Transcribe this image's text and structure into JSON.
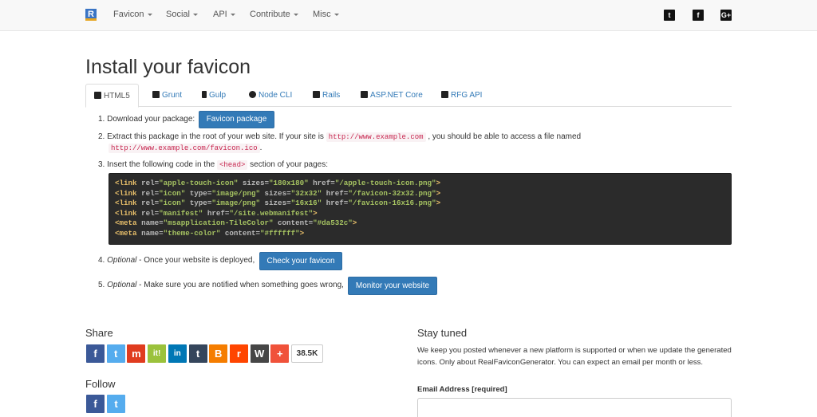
{
  "nav": {
    "brand_letter": "R",
    "items": [
      {
        "label": "Favicon"
      },
      {
        "label": "Social"
      },
      {
        "label": "API"
      },
      {
        "label": "Contribute"
      },
      {
        "label": "Misc"
      }
    ],
    "social": [
      {
        "name": "twitter-icon",
        "glyph": "t"
      },
      {
        "name": "facebook-icon",
        "glyph": "f"
      },
      {
        "name": "google-plus-icon",
        "glyph": "G+"
      }
    ]
  },
  "page_title": "Install your favicon",
  "tabs": [
    {
      "label": "HTML5"
    },
    {
      "label": "Grunt"
    },
    {
      "label": "Gulp"
    },
    {
      "label": "Node CLI"
    },
    {
      "label": "Rails"
    },
    {
      "label": "ASP.NET Core"
    },
    {
      "label": "RFG API"
    }
  ],
  "steps": {
    "s1_text": "1. Download your package:",
    "s1_button": "Favicon package",
    "s2_text_a": "2. Extract this package in the root of your web site. If your site is",
    "s2_code_a": "http://www.example.com",
    "s2_text_b": ", you should be able to access a file named",
    "s2_code_b": "http://www.example.com/favicon.ico",
    "s2_text_c": ".",
    "s3_text_a": "3. Insert the following code in the",
    "s3_code": "<head>",
    "s3_text_b": "section of your pages:",
    "s4_num": "4.",
    "s4_em": "Optional",
    "s4_text": "- Once your website is deployed,",
    "s4_button": "Check your favicon",
    "s5_num": "5.",
    "s5_em": "Optional",
    "s5_text": "- Make sure you are notified when something goes wrong,",
    "s5_button": "Monitor your website"
  },
  "code_lines": [
    {
      "tag": "<link",
      "parts": [
        [
          "rel=",
          "\"apple-touch-icon\""
        ],
        [
          "sizes=",
          "\"180x180\""
        ],
        [
          "href=",
          "\"/apple-touch-icon.png\""
        ]
      ]
    },
    {
      "tag": "<link",
      "parts": [
        [
          "rel=",
          "\"icon\""
        ],
        [
          "type=",
          "\"image/png\""
        ],
        [
          "sizes=",
          "\"32x32\""
        ],
        [
          "href=",
          "\"/favicon-32x32.png\""
        ]
      ]
    },
    {
      "tag": "<link",
      "parts": [
        [
          "rel=",
          "\"icon\""
        ],
        [
          "type=",
          "\"image/png\""
        ],
        [
          "sizes=",
          "\"16x16\""
        ],
        [
          "href=",
          "\"/favicon-16x16.png\""
        ]
      ]
    },
    {
      "tag": "<link",
      "parts": [
        [
          "rel=",
          "\"manifest\""
        ],
        [
          "href=",
          "\"/site.webmanifest\""
        ]
      ]
    },
    {
      "tag": "<meta",
      "parts": [
        [
          "name=",
          "\"msapplication-TileColor\""
        ],
        [
          "content=",
          "\"#da532c\""
        ]
      ]
    },
    {
      "tag": "<meta",
      "parts": [
        [
          "name=",
          "\"theme-color\""
        ],
        [
          "content=",
          "\"#ffffff\""
        ]
      ]
    }
  ],
  "share": {
    "heading": "Share",
    "buttons": [
      {
        "name": "facebook-share-icon",
        "glyph": "f",
        "color": "#3b5998"
      },
      {
        "name": "twitter-share-icon",
        "glyph": "t",
        "color": "#55acee"
      },
      {
        "name": "mix-share-icon",
        "glyph": "m",
        "color": "#e03c1f"
      },
      {
        "name": "scoopit-share-icon",
        "glyph": "it!",
        "color": "#9bc23c"
      },
      {
        "name": "linkedin-share-icon",
        "glyph": "in",
        "color": "#0077b5"
      },
      {
        "name": "tumblr-share-icon",
        "glyph": "t",
        "color": "#35465c"
      },
      {
        "name": "blogger-share-icon",
        "glyph": "B",
        "color": "#f57d00"
      },
      {
        "name": "reddit-share-icon",
        "glyph": "r",
        "color": "#ff4500"
      },
      {
        "name": "wordpress-share-icon",
        "glyph": "W",
        "color": "#464646"
      },
      {
        "name": "more-share-icon",
        "glyph": "+",
        "color": "#f0523a"
      }
    ],
    "count": "38.5K"
  },
  "follow": {
    "heading": "Follow",
    "buttons": [
      {
        "name": "facebook-follow-icon",
        "glyph": "f",
        "color": "#3b5998"
      },
      {
        "name": "twitter-follow-icon",
        "glyph": "t",
        "color": "#55acee"
      }
    ]
  },
  "stay_tuned": {
    "heading": "Stay tuned",
    "text": "We keep you posted whenever a new platform is supported or when we update the generated icons. Only about RealFaviconGenerator. You can expect an email per month or less.",
    "email_label": "Email Address [required]",
    "email_value": ""
  }
}
